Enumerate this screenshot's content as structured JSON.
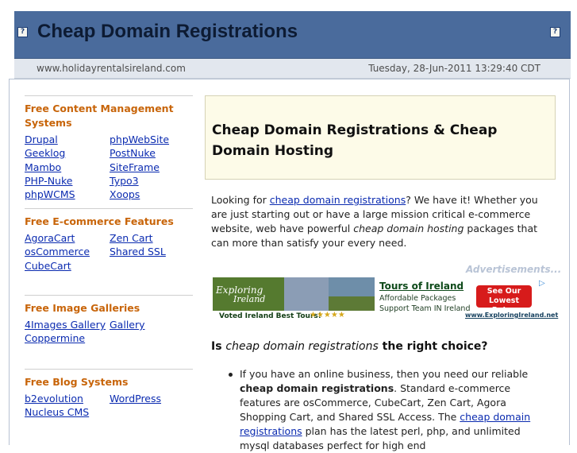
{
  "header": {
    "title": "Cheap Domain Registrations",
    "url": "www.holidayrentalsireland.com",
    "datetime": "Tuesday, 28-Jun-2011 13:29:40 CDT",
    "icon_left": "?",
    "icon_right": "?"
  },
  "sidebar": {
    "cms": {
      "title": "Free Content Management Systems",
      "links": [
        "Drupal",
        "phpWebSite",
        "Geeklog",
        "PostNuke",
        "Mambo",
        "SiteFrame",
        "PHP-Nuke",
        "Typo3",
        "phpWCMS",
        "Xoops"
      ]
    },
    "ecommerce": {
      "title": "Free E-commerce Features",
      "links": [
        "AgoraCart",
        "Zen Cart",
        "osCommerce",
        "Shared SSL",
        "CubeCart"
      ]
    },
    "galleries": {
      "title": "Free Image Galleries",
      "links": [
        "4Images Gallery",
        "Gallery",
        "Coppermine"
      ]
    },
    "blogs": {
      "title": "Free Blog Systems",
      "links": [
        "b2evolution",
        "WordPress",
        "Nucleus CMS"
      ]
    }
  },
  "main": {
    "headline": "Cheap Domain Registrations & Cheap Domain Hosting",
    "intro_1": "Looking for ",
    "intro_link": "cheap domain registrations",
    "intro_2": "? We have it! Whether you are just starting out or have a large mission critical e-commerce website, web have powerful ",
    "intro_em": "cheap domain hosting",
    "intro_3": " packages that can more than satisfy your every need.",
    "ads_label": "Advertisements...",
    "question_1": "Is ",
    "question_em": "cheap domain registrations",
    "question_2": " the right choice?",
    "bullet_1a": "If you have an online business, then you need our reliable ",
    "bullet_1b": "cheap domain registrations",
    "bullet_1c": ". Standard e-commerce features are osCommerce, CubeCart, Zen Cart, Agora Shopping Cart, and Shared SSL Access. The ",
    "bullet_1d": "cheap domain registrations",
    "bullet_1e": " plan has the latest perl, php, and unlimited mysql databases perfect for high end"
  },
  "ad": {
    "brand_1": "Exploring",
    "brand_2": "Ireland",
    "voted": "Voted Ireland Best Tours!",
    "stars": "★★★★★",
    "title": "Tours of Ireland",
    "line1": "Affordable Packages",
    "line2": "Support Team IN Ireland",
    "button": "See Our Lowest Rates",
    "url": "www.ExploringIreland.net",
    "choice_icon": "▷"
  },
  "colors": {
    "header_bg": "#4a6b9c",
    "link": "#0b2bb0",
    "section_title": "#c8650a",
    "headline_box_bg": "#fdfbe8"
  }
}
